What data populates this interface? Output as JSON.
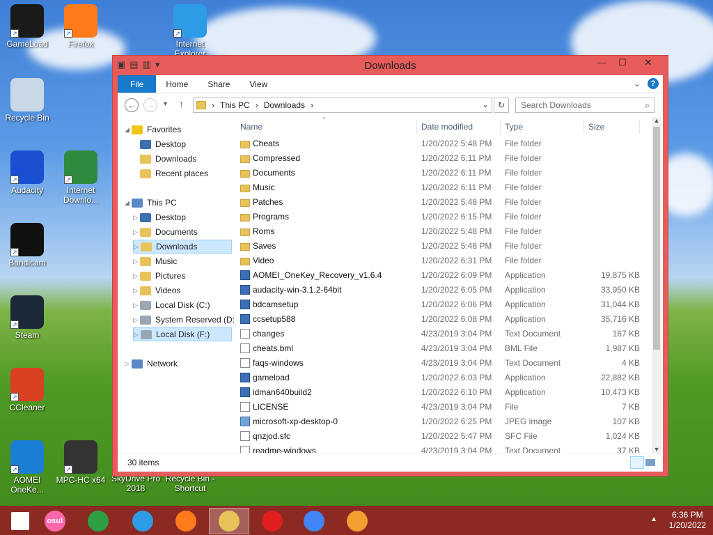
{
  "desktop": {
    "icons": [
      {
        "label": "GameLoad",
        "icon": "gameload-icon",
        "color": "#1a1a1a"
      },
      {
        "label": "Firefox",
        "icon": "firefox-icon",
        "color": "#ff7a1a"
      },
      {
        "label": "Internet Explorer",
        "icon": "ie-icon",
        "color": "#2d9be6"
      },
      {
        "label": "Recycle Bin",
        "icon": "recycle-bin-icon",
        "color": "#c9d8e6"
      },
      {
        "label": "Audacity",
        "icon": "audacity-icon",
        "color": "#1a4fd1"
      },
      {
        "label": "Internet Downlo...",
        "icon": "idm-icon",
        "color": "#2e8b3d"
      },
      {
        "label": "Bandicam",
        "icon": "bandicam-icon",
        "color": "#111111"
      },
      {
        "label": "Steam",
        "icon": "steam-icon",
        "color": "#1b2838"
      },
      {
        "label": "CCleaner",
        "icon": "ccleaner-icon",
        "color": "#d9401f"
      },
      {
        "label": "AOMEI OneKe...",
        "icon": "aomei-icon",
        "color": "#1c7fd6"
      },
      {
        "label": "MPC-HC x64",
        "icon": "mpc-hc-icon",
        "color": "#333333"
      },
      {
        "label": "SkyDrive Pro 2018",
        "icon": "",
        "color": ""
      },
      {
        "label": "Recycle Bin - Shortcut",
        "icon": "",
        "color": ""
      }
    ]
  },
  "window": {
    "title": "Downloads",
    "ribbon_tabs": [
      "File",
      "Home",
      "Share",
      "View"
    ],
    "address": {
      "parts": [
        "This PC",
        "Downloads"
      ]
    },
    "search_placeholder": "Search Downloads",
    "accent": "#e85b5b"
  },
  "nav": {
    "favorites": "Favorites",
    "favorites_items": [
      "Desktop",
      "Downloads",
      "Recent places"
    ],
    "this_pc": "This PC",
    "this_pc_items": [
      "Desktop",
      "Documents",
      "Downloads",
      "Music",
      "Pictures",
      "Videos",
      "Local Disk (C:)",
      "System Reserved (D:",
      "Local Disk (F:)"
    ],
    "network": "Network",
    "selected": [
      "Downloads",
      "Local Disk (F:)"
    ]
  },
  "columns": [
    "Name",
    "Date modified",
    "Type",
    "Size"
  ],
  "files": [
    {
      "name": "Cheats",
      "date": "1/20/2022 5:48 PM",
      "type": "File folder",
      "size": "",
      "kind": "folder"
    },
    {
      "name": "Compressed",
      "date": "1/20/2022 6:11 PM",
      "type": "File folder",
      "size": "",
      "kind": "folder"
    },
    {
      "name": "Documents",
      "date": "1/20/2022 6:11 PM",
      "type": "File folder",
      "size": "",
      "kind": "folder"
    },
    {
      "name": "Music",
      "date": "1/20/2022 6:11 PM",
      "type": "File folder",
      "size": "",
      "kind": "folder"
    },
    {
      "name": "Patches",
      "date": "1/20/2022 5:48 PM",
      "type": "File folder",
      "size": "",
      "kind": "folder"
    },
    {
      "name": "Programs",
      "date": "1/20/2022 6:15 PM",
      "type": "File folder",
      "size": "",
      "kind": "folder"
    },
    {
      "name": "Roms",
      "date": "1/20/2022 5:48 PM",
      "type": "File folder",
      "size": "",
      "kind": "folder"
    },
    {
      "name": "Saves",
      "date": "1/20/2022 5:48 PM",
      "type": "File folder",
      "size": "",
      "kind": "folder"
    },
    {
      "name": "Video",
      "date": "1/20/2022 6:31 PM",
      "type": "File folder",
      "size": "",
      "kind": "folder"
    },
    {
      "name": "AOMEI_OneKey_Recovery_v1.6.4",
      "date": "1/20/2022 6:09 PM",
      "type": "Application",
      "size": "19,875 KB",
      "kind": "app"
    },
    {
      "name": "audacity-win-3.1.2-64bit",
      "date": "1/20/2022 6:05 PM",
      "type": "Application",
      "size": "33,950 KB",
      "kind": "app"
    },
    {
      "name": "bdcamsetup",
      "date": "1/20/2022 6:06 PM",
      "type": "Application",
      "size": "31,044 KB",
      "kind": "app"
    },
    {
      "name": "ccsetup588",
      "date": "1/20/2022 6:08 PM",
      "type": "Application",
      "size": "35,716 KB",
      "kind": "app"
    },
    {
      "name": "changes",
      "date": "4/23/2019 3:04 PM",
      "type": "Text Document",
      "size": "167 KB",
      "kind": "doc"
    },
    {
      "name": "cheats.bml",
      "date": "4/23/2019 3:04 PM",
      "type": "BML File",
      "size": "1,987 KB",
      "kind": "doc"
    },
    {
      "name": "faqs-windows",
      "date": "4/23/2019 3:04 PM",
      "type": "Text Document",
      "size": "4 KB",
      "kind": "doc"
    },
    {
      "name": "gameload",
      "date": "1/20/2022 6:03 PM",
      "type": "Application",
      "size": "22,882 KB",
      "kind": "app"
    },
    {
      "name": "idman640build2",
      "date": "1/20/2022 6:10 PM",
      "type": "Application",
      "size": "10,473 KB",
      "kind": "app"
    },
    {
      "name": "LICENSE",
      "date": "4/23/2019 3:04 PM",
      "type": "File",
      "size": "7 KB",
      "kind": "doc"
    },
    {
      "name": "microsoft-xp-desktop-0",
      "date": "1/20/2022 6:25 PM",
      "type": "JPEG image",
      "size": "107 KB",
      "kind": "img"
    },
    {
      "name": "qnzjod.sfc",
      "date": "1/20/2022 5:47 PM",
      "type": "SFC File",
      "size": "1,024 KB",
      "kind": "doc"
    },
    {
      "name": "readme-windows",
      "date": "4/23/2019 3:04 PM",
      "type": "Text Document",
      "size": "37 KB",
      "kind": "doc"
    }
  ],
  "status": {
    "item_count": "30 items"
  },
  "taskbar": {
    "apps": [
      {
        "name": "start",
        "icon": "windows-start-icon",
        "color": "#ffffff"
      },
      {
        "name": "osu",
        "icon": "osu-icon",
        "color": "#ff66aa"
      },
      {
        "name": "store",
        "icon": "store-icon",
        "color": "#2ea043"
      },
      {
        "name": "ie",
        "icon": "ie-icon",
        "color": "#2d9be6"
      },
      {
        "name": "firefox",
        "icon": "firefox-icon",
        "color": "#ff7a1a"
      },
      {
        "name": "explorer",
        "icon": "file-explorer-icon",
        "color": "#e8c35c"
      },
      {
        "name": "bandicam",
        "icon": "bandicam-icon",
        "color": "#e01e1e"
      },
      {
        "name": "chrome",
        "icon": "chrome-icon",
        "color": "#4285f4"
      },
      {
        "name": "media",
        "icon": "media-player-icon",
        "color": "#f0a030"
      }
    ],
    "osu_label": "osu!",
    "time": "6:36 PM",
    "date": "1/20/2022"
  }
}
